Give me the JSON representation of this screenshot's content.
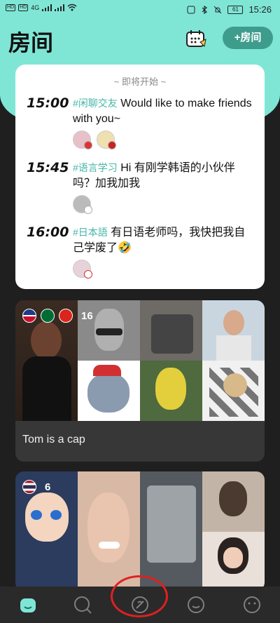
{
  "status_bar": {
    "left_badges": [
      "HD",
      "HD"
    ],
    "network": "4G",
    "battery": "61",
    "time": "15:26"
  },
  "header": {
    "title": "房间",
    "add_room_label": "+房间",
    "calendar_icon": "calendar-icon"
  },
  "upcoming": {
    "header": "~ 即将开始 ~",
    "events": [
      {
        "time": "15:00",
        "tag": "#闲聊交友",
        "text": " Would like to make friends with you~"
      },
      {
        "time": "15:45",
        "tag": "#语言学习",
        "text": " Hi 有刚学韩语的小伙伴吗？加我加我"
      },
      {
        "time": "16:00",
        "tag": "#日本語",
        "text": " 有日语老师吗，我快把我自己学废了🤣"
      }
    ]
  },
  "rooms": [
    {
      "count": "16",
      "caption": "Tom is a cap",
      "flags": [
        "us",
        "sa",
        "vn"
      ]
    },
    {
      "count": "6",
      "caption": "",
      "flags": [
        "th"
      ]
    }
  ],
  "nav": {
    "items": [
      "home-icon",
      "search-icon",
      "explore-icon",
      "chat-icon",
      "profile-icon"
    ]
  }
}
